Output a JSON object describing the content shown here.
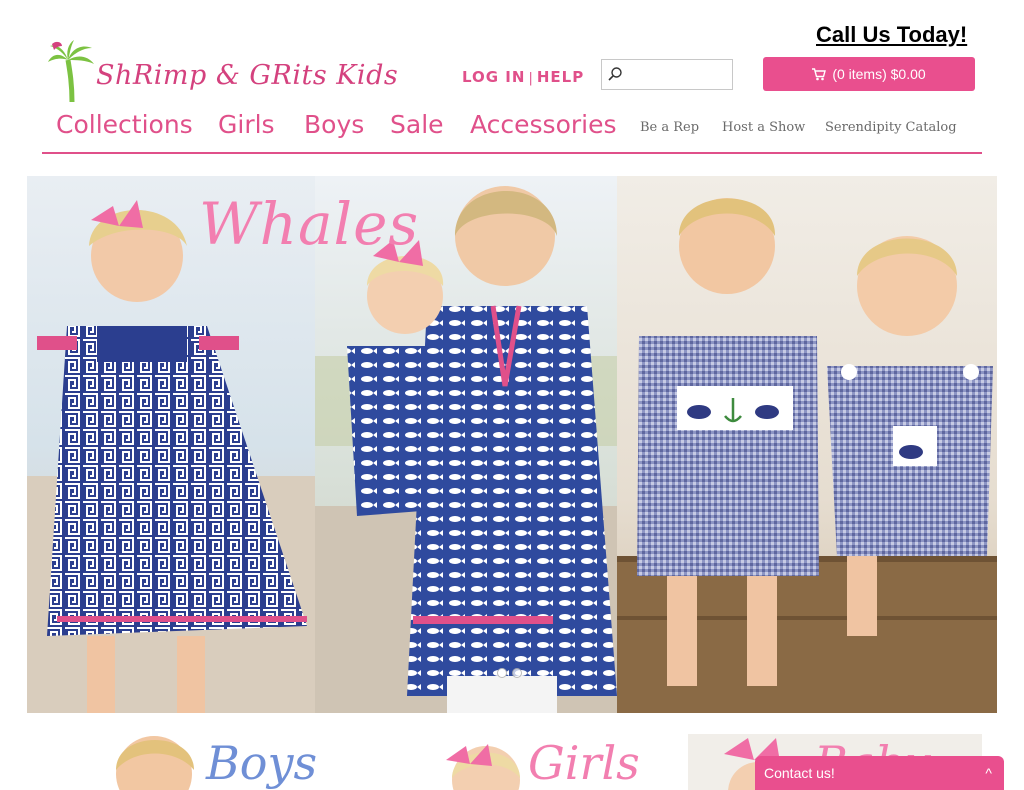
{
  "header": {
    "call_us": "Call Us Today!",
    "logo_text": "ShRimp & GRits Kids",
    "login": "LOG IN",
    "separator": "|",
    "help": "HELP",
    "search_placeholder": "",
    "cart": "(0 items) $0.00"
  },
  "nav": {
    "main": [
      "Collections",
      "Girls",
      "Boys",
      "Sale",
      "Accessories"
    ],
    "sub": [
      "Be a Rep",
      "Host a Show",
      "Serendipity Catalog"
    ]
  },
  "hero": {
    "title": "Whales",
    "slide_count": 2,
    "active_slide": 1
  },
  "categories": [
    {
      "label": "Boys",
      "color": "#6f8fd6"
    },
    {
      "label": "Girls",
      "color": "#f27fb0"
    },
    {
      "label": "Baby",
      "color": "#f27fb0"
    }
  ],
  "contact": {
    "label": "Contact us!",
    "chevron": "^"
  },
  "colors": {
    "brand_pink": "#e94f8e",
    "nav_pink": "#e0508a",
    "sub_gray": "#6a6a6a"
  }
}
